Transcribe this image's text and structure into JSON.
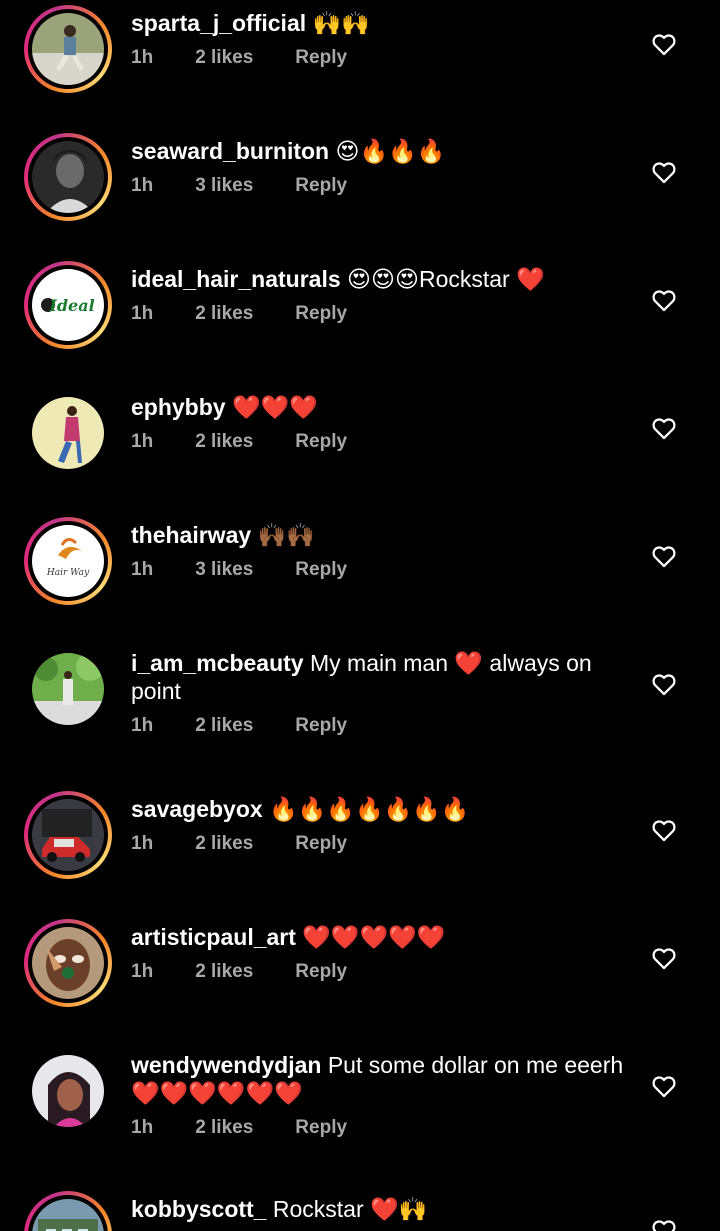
{
  "comments": [
    {
      "username": "sparta_j_official",
      "text": "🙌🙌",
      "time": "1h",
      "likes": "2 likes",
      "reply": "Reply",
      "avatar": "photo-person-outdoor",
      "ring": true
    },
    {
      "username": "seaward_burniton",
      "text": "😍🔥🔥🔥",
      "time": "1h",
      "likes": "3 likes",
      "reply": "Reply",
      "avatar": "photo-bw-portrait",
      "ring": true
    },
    {
      "username": "ideal_hair_naturals",
      "text": "😍😍😍Rockstar ❤️",
      "time": "1h",
      "likes": "2 likes",
      "reply": "Reply",
      "avatar": "logo-ideal",
      "logo_text": "Ideal",
      "ring": true
    },
    {
      "username": "ephybby",
      "text": "❤️❤️❤️",
      "time": "1h",
      "likes": "2 likes",
      "reply": "Reply",
      "avatar": "photo-person-standing",
      "ring": false
    },
    {
      "username": "thehairway",
      "text": "🙌🏾🙌🏾",
      "time": "1h",
      "likes": "3 likes",
      "reply": "Reply",
      "avatar": "logo-hairway",
      "logo_text": "Hair Way",
      "ring": true
    },
    {
      "username": "i_am_mcbeauty",
      "text": "My main man ❤️ always on point",
      "time": "1h",
      "likes": "2 likes",
      "reply": "Reply",
      "avatar": "photo-garden",
      "ring": false
    },
    {
      "username": "savagebyox",
      "text": "🔥🔥🔥🔥🔥🔥🔥",
      "time": "1h",
      "likes": "2 likes",
      "reply": "Reply",
      "avatar": "photo-car",
      "ring": true
    },
    {
      "username": "artisticpaul_art",
      "text": "❤️❤️❤️❤️❤️",
      "time": "1h",
      "likes": "2 likes",
      "reply": "Reply",
      "avatar": "photo-painted-face",
      "ring": true
    },
    {
      "username": "wendywendydjan",
      "text": "Put some dollar on me eeerh❤️❤️❤️❤️❤️❤️",
      "time": "1h",
      "likes": "2 likes",
      "reply": "Reply",
      "avatar": "photo-selfie",
      "ring": false
    },
    {
      "username": "kobbyscott_",
      "text": "Rockstar ❤️🙌",
      "time": "",
      "likes": "",
      "reply": "",
      "avatar": "photo-building",
      "ring": true
    }
  ],
  "colors": {
    "background": "#000000",
    "meta_text": "#a8a8a8",
    "ring_from": "#f58529",
    "ring_to": "#dd2a7b",
    "red_heart": "#e0202b"
  },
  "icons": {
    "like": "heart-outline-icon"
  }
}
